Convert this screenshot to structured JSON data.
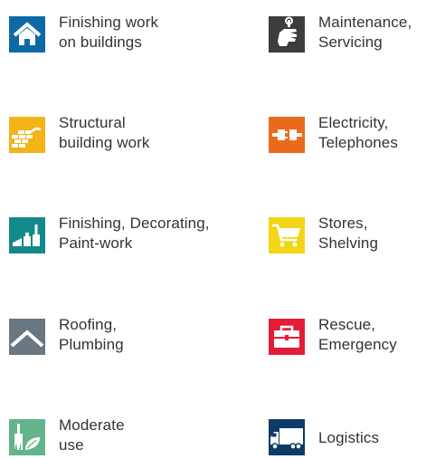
{
  "colors": {
    "finishing": "#0b6aa6",
    "maintenance": "#3d3d3d",
    "structural": "#f2b417",
    "electricity": "#ea6a1b",
    "decorating": "#128a8a",
    "stores": "#f2d516",
    "roofing": "#6a7680",
    "rescue": "#e31c38",
    "moderate": "#63b48a",
    "logistics": "#0e3a66"
  },
  "categories": [
    {
      "icon": "house-icon",
      "line1": "Finishing work",
      "line2": "on buildings"
    },
    {
      "icon": "hand-wrench-icon",
      "line1": "Maintenance,",
      "line2": "Servicing"
    },
    {
      "icon": "brick-wall-icon",
      "line1": "Structural",
      "line2": "building work"
    },
    {
      "icon": "plug-icon",
      "line1": "Electricity,",
      "line2": "Telephones"
    },
    {
      "icon": "paint-tools-icon",
      "line1": "Finishing, Decorating,",
      "line2": "Paint-work"
    },
    {
      "icon": "shopping-cart-icon",
      "line1": "Stores,",
      "line2": "Shelving"
    },
    {
      "icon": "roof-icon",
      "line1": "Roofing,",
      "line2": "Plumbing"
    },
    {
      "icon": "toolbox-icon",
      "line1": "Rescue,",
      "line2": "Emergency"
    },
    {
      "icon": "brush-leaf-icon",
      "line1": "Moderate",
      "line2": "use"
    },
    {
      "icon": "truck-icon",
      "line1": "Logistics",
      "line2": ""
    }
  ]
}
